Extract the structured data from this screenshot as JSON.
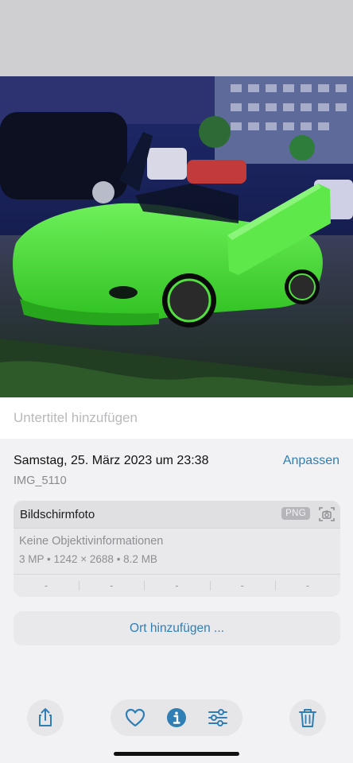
{
  "caption": {
    "placeholder": "Untertitel hinzufügen"
  },
  "info": {
    "date": "Samstag, 25. März 2023 um 23:38",
    "adjust_label": "Anpassen",
    "filename": "IMG_5110"
  },
  "card": {
    "title": "Bildschirmfoto",
    "badge": "PNG",
    "lens": "Keine Objektivinformationen",
    "specs": "3 MP • 1242 × 2688 • 8.2 MB",
    "exif": [
      "-",
      "-",
      "-",
      "-",
      "-"
    ]
  },
  "location": {
    "label": "Ort hinzufügen ..."
  },
  "toolbar": {
    "icons": [
      "share-icon",
      "heart-icon",
      "info-icon",
      "adjust-icon",
      "trash-icon"
    ],
    "accent": "#2f7fb5"
  },
  "photo": {
    "car_color": "#4fe03a"
  }
}
